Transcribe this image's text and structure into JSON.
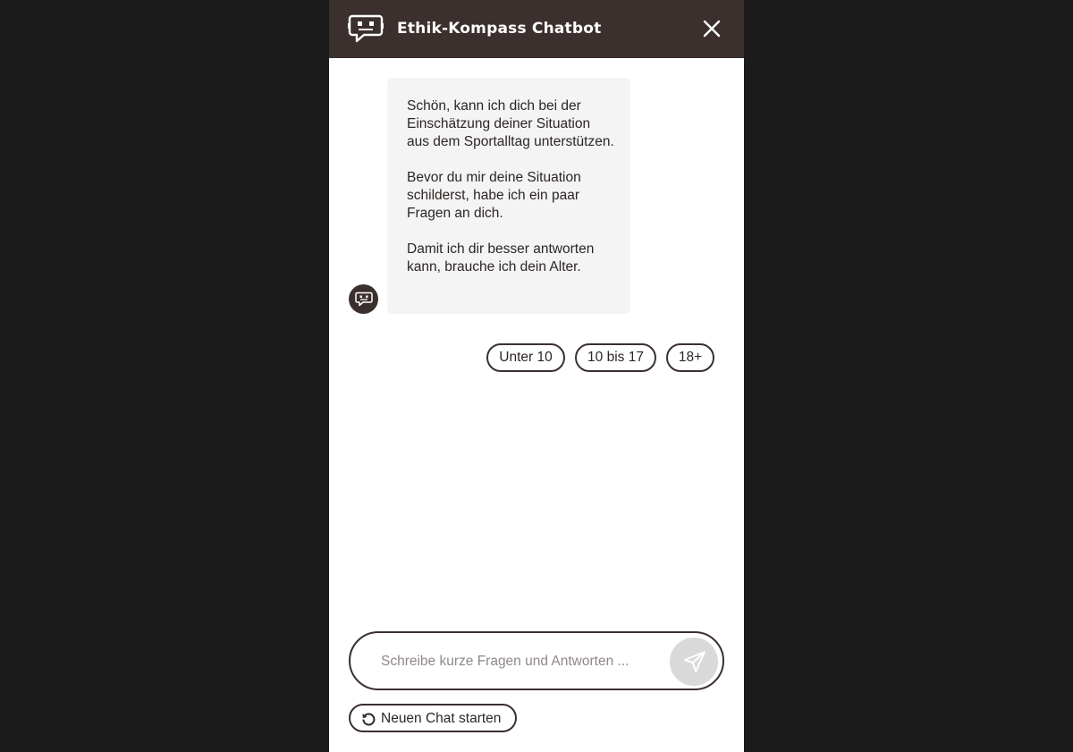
{
  "header": {
    "title": "Ethik-Kompass Chatbot",
    "logo_icon": "chatbot-robot-icon",
    "close_icon": "close-icon",
    "background_color": "#3b302e"
  },
  "chat": {
    "bot_message": {
      "paragraphs": [
        "Schön, kann ich dich bei der Einschätzung deiner Situation aus dem Sportalltag unterstützen.",
        "Bevor du mir deine Situation schilderst, habe ich ein paar Fragen an dich.",
        "Damit ich dir besser antworten kann, brauche ich dein Alter."
      ]
    },
    "quick_replies": [
      "Unter 10",
      "10 bis 17",
      "18+"
    ]
  },
  "composer": {
    "placeholder": "Schreibe kurze Fragen und Antworten ...",
    "value": "",
    "send_icon": "send-icon"
  },
  "footer": {
    "new_chat_label": "Neuen Chat starten",
    "new_chat_icon": "restart-icon"
  },
  "colors": {
    "accent": "#3b302e",
    "bubble_bg": "#f4f4f4",
    "send_bg": "#d9d9d9",
    "backdrop": "#1b1b1b"
  }
}
